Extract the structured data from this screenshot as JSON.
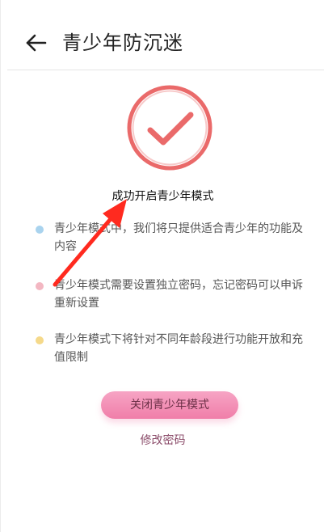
{
  "header": {
    "title": "青少年防沉迷"
  },
  "status": {
    "success_text": "成功开启青少年模式"
  },
  "tips": [
    {
      "text": "青少年模式中，我们将只提供适合青少年的功能及内容",
      "dot_color": "#a9d3ee"
    },
    {
      "text": "青少年模式需要设置独立密码，忘记密码可以申诉重新设置",
      "dot_color": "#f3b7c2"
    },
    {
      "text": "青少年模式下将针对不同年龄段进行功能开放和充值限制",
      "dot_color": "#f5d98a"
    }
  ],
  "actions": {
    "close_mode_label": "关闭青少年模式",
    "change_password_label": "修改密码"
  },
  "colors": {
    "accent_check": "#ea6a6a",
    "check_ring_inner": "#f7c9c9",
    "button_gradient": [
      "#f6a4c4",
      "#f07ea9"
    ],
    "annotation_arrow": "#ff2a1f"
  }
}
